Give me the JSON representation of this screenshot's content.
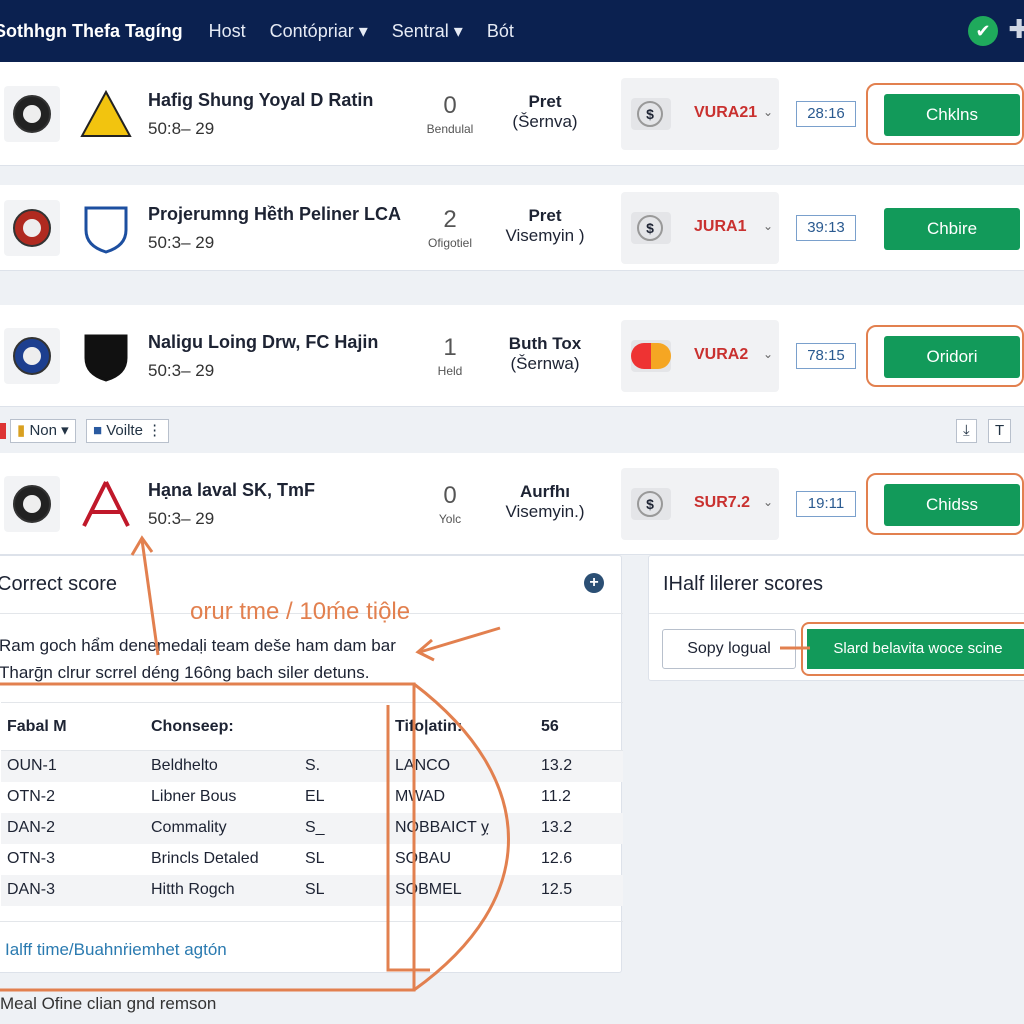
{
  "nav": {
    "brand": "Sothhgn Thefa Tagíng",
    "items": [
      "Host",
      "Contópriar ▾",
      "Sentral ▾",
      "Bót"
    ]
  },
  "matches": [
    {
      "title": "Hafig Shung Yoyal D Ratin",
      "sub": "50:8– 29",
      "score": "0",
      "score_label": "Bendulal",
      "market": "Pret",
      "market_sub": "(Šernva)",
      "odds_code": "VURA21",
      "odds_icon": "dollar-coin",
      "time": "28:16",
      "button": "Chklns",
      "ring": true
    },
    {
      "title": "Projerumng Hềth Peliner LCA",
      "sub": "50:3– 29",
      "score": "2",
      "score_label": "Ofigotiel",
      "market": "Pret",
      "market_sub": "Visemyin )",
      "odds_code": "JURA1",
      "odds_icon": "dollar-coin",
      "time": "39:13",
      "button": "Chbire",
      "ring": false
    },
    {
      "title": "Naligu Loing Drw, FC Hajin",
      "sub": "50:3– 29",
      "score": "1",
      "score_label": "Held",
      "market": "Buth Tox",
      "market_sub": "(Šernwa)",
      "odds_code": "VURA2",
      "odds_icon": "mastercard",
      "time": "78:15",
      "button": "Oridori",
      "ring": true
    },
    {
      "title": "Hạna laval SK, TmF",
      "sub": "50:3– 29",
      "score": "0",
      "score_label": "Yolc",
      "market": "Aurfhı",
      "market_sub": "Visemyin.)",
      "odds_code": "SUR7.2",
      "odds_icon": "dollar-coin",
      "time": "19:11",
      "button": "Chidss",
      "ring": true
    }
  ],
  "toolbar": {
    "filter1": "Non",
    "filter2": "Voilte",
    "right_btn": "T"
  },
  "correct": {
    "title": "Correct score",
    "annotation": "orur tme / 10ḿe tiộle",
    "desc1": "Ram goch hẩm denemedaḷi team dešе ham dam bar",
    "desc2": "Tharḡn clrur scrrel déng 16ông bach siler detuns.",
    "headers": [
      "Fabal M",
      "Chonseep:",
      "",
      "Tifo|atin:",
      "56"
    ],
    "rows": [
      [
        "OUN-1",
        "Beldhelto",
        "S.",
        "LANCO",
        "13.2"
      ],
      [
        "OTN-2",
        "Libner Bous",
        "EL",
        "MWAD",
        "11.2"
      ],
      [
        "DAN-2",
        "Commality",
        "S_",
        "NOBBAICT ỵ",
        "13.2"
      ],
      [
        "OTN-3",
        "Brincls Detaled",
        "SL",
        "SOBAU",
        "12.6"
      ],
      [
        "DAN-3",
        "Hitth Rogch",
        "SL",
        "SOBMEL",
        "12.5"
      ]
    ],
    "link": "Ialff time/Buahnṙiemhet agtón"
  },
  "half": {
    "title": "IHalf lilerer scores",
    "btn1": "Sopy logual",
    "btn2": "Slard belavita woce scine"
  },
  "footer": "Meal Ofine clian gnd remson",
  "colors": {
    "nav": "#0b2150",
    "green": "#129a5a",
    "annotation": "#e2804f",
    "odds": "#c9312f"
  }
}
